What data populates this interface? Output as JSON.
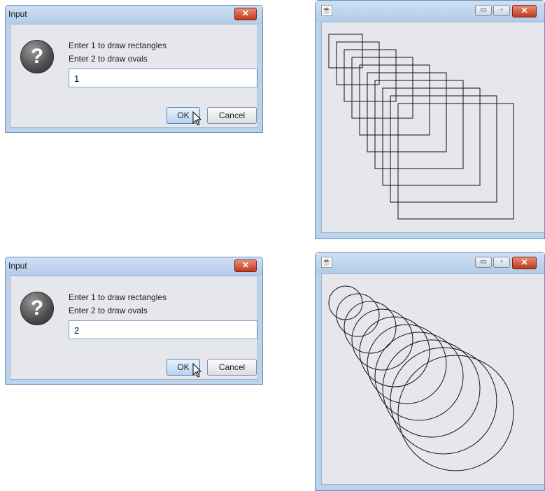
{
  "dialogs": [
    {
      "title": "Input",
      "close_glyph": "✕",
      "message_line1": "Enter 1 to draw rectangles",
      "message_line2": "Enter 2 to draw ovals",
      "input_value": "1",
      "ok_label": "OK",
      "cancel_label": "Cancel",
      "icon": "question-icon"
    },
    {
      "title": "Input",
      "close_glyph": "✕",
      "message_line1": "Enter 1 to draw rectangles",
      "message_line2": "Enter 2 to draw ovals",
      "input_value": "2",
      "ok_label": "OK",
      "cancel_label": "Cancel",
      "icon": "question-icon"
    }
  ],
  "frames": [
    {
      "drawing": "rectangles",
      "shape_count": 10,
      "window_icon": "java-cup-icon",
      "buttons": {
        "minimize": "▭",
        "maximize": "▫",
        "close": "✕"
      }
    },
    {
      "drawing": "ovals",
      "shape_count": 10,
      "window_icon": "java-cup-icon",
      "buttons": {
        "minimize": "▭",
        "maximize": "▫",
        "close": "✕"
      }
    }
  ],
  "colors": {
    "title_bar": "#bcd3ec",
    "client": "#e6e7ec",
    "close_button": "#c8452a",
    "stroke": "#111111"
  }
}
